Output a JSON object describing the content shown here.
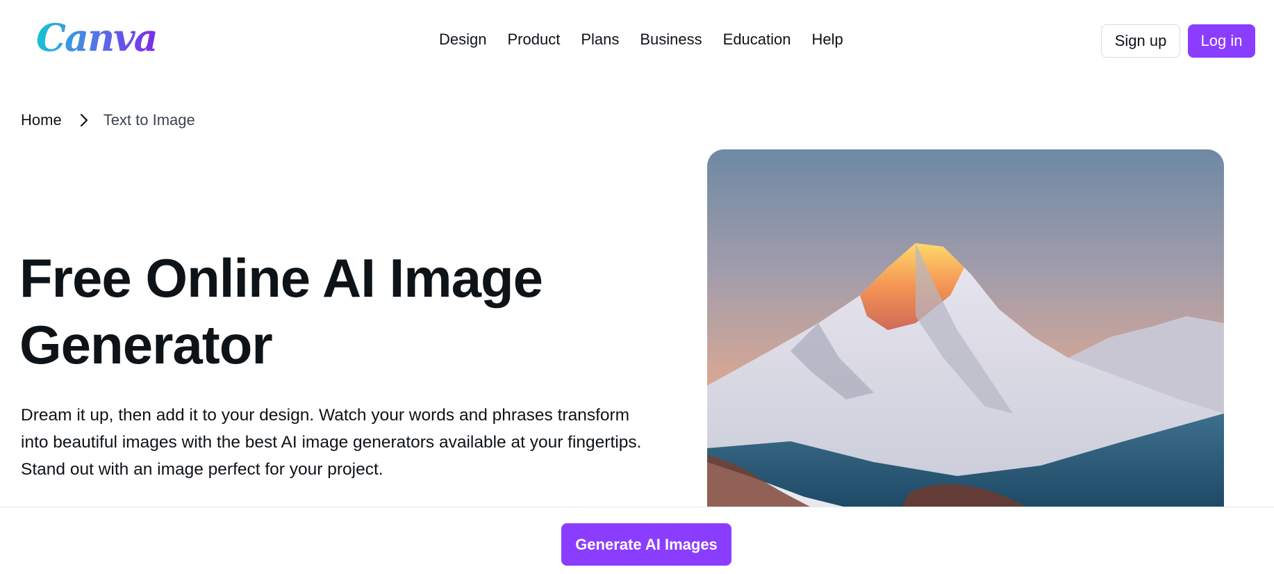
{
  "header": {
    "logo_text": "Canva",
    "nav": [
      {
        "label": "Design"
      },
      {
        "label": "Product"
      },
      {
        "label": "Plans"
      },
      {
        "label": "Business"
      },
      {
        "label": "Education"
      },
      {
        "label": "Help"
      }
    ],
    "signup_label": "Sign up",
    "login_label": "Log in"
  },
  "breadcrumb": {
    "home": "Home",
    "separator_icon": "chevron-right-icon",
    "current": "Text to Image"
  },
  "hero": {
    "title": "Free Online AI Image Generator",
    "description": "Dream it up, then add it to your design. Watch your words and phrases transform into beautiful images with the best AI image generators available at your fingertips. Stand out with an image perfect for your project.",
    "image_subject": "snowy-mountain-peak-at-sunset"
  },
  "cta": {
    "generate_label": "Generate AI Images"
  },
  "colors": {
    "brand_purple": "#8b3dff",
    "text": "#0e1318"
  }
}
